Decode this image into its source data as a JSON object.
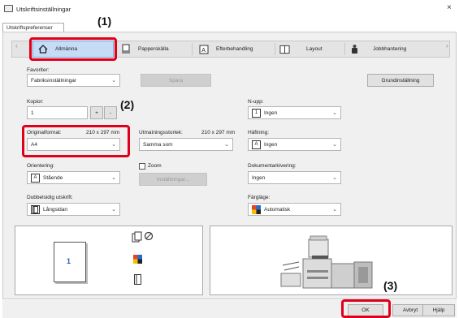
{
  "window": {
    "title": "Utskriftsinställningar",
    "close_symbol": "×"
  },
  "prefs_tab": "Utskriftspreferenser",
  "tabs": [
    {
      "label": "Allmänna",
      "icon": "home-icon",
      "selected": true
    },
    {
      "label": "Papperskälla",
      "icon": "paper-tray-icon"
    },
    {
      "label": "Efterbehandling",
      "icon": "finishing-icon"
    },
    {
      "label": "Layout",
      "icon": "layout-icon"
    },
    {
      "label": "Jobbhantering",
      "icon": "job-icon"
    }
  ],
  "tab_nav": {
    "left": "‹",
    "right": "›"
  },
  "favorites": {
    "label": "Favoriter:",
    "value": "Fabriksinställningar",
    "save_label": "Spara",
    "defaults_label": "Grundinställning"
  },
  "copies": {
    "label": "Kopior:",
    "value": "1",
    "plus": "+",
    "minus": "-"
  },
  "original_size": {
    "label": "Originalformat:",
    "dims": "210 x 297 mm",
    "value": "A4"
  },
  "output_size": {
    "label": "Utmatningsstorlek:",
    "dims": "210 x 297 mm",
    "value": "Samma som"
  },
  "orientation": {
    "label": "Orientering:",
    "value": "Stående",
    "icon_glyph": "A"
  },
  "zoom": {
    "label": "Zoom",
    "settings_label": "Inställningar..."
  },
  "duplex": {
    "label": "Dubbelsidig utskrift:",
    "value": "Långsidan"
  },
  "nup": {
    "label": "N-upp:",
    "value": "Ingen",
    "icon_glyph": "1"
  },
  "stapling": {
    "label": "Häftning:",
    "value": "Ingen",
    "icon_glyph": "A"
  },
  "doc_filing": {
    "label": "Dokumentarkivering:",
    "value": "Ingen"
  },
  "color_mode": {
    "label": "Färgläge:",
    "value": "Automatisk"
  },
  "preview": {
    "page_number": "1"
  },
  "callouts": {
    "c1": "(1)",
    "c2": "(2)",
    "c3": "(3)"
  },
  "buttons": {
    "ok": "OK",
    "cancel": "Avbryt",
    "help": "Hjälp"
  },
  "colors": {
    "callout_red": "#e0001b",
    "selected_tab": "#c6dbf5"
  }
}
